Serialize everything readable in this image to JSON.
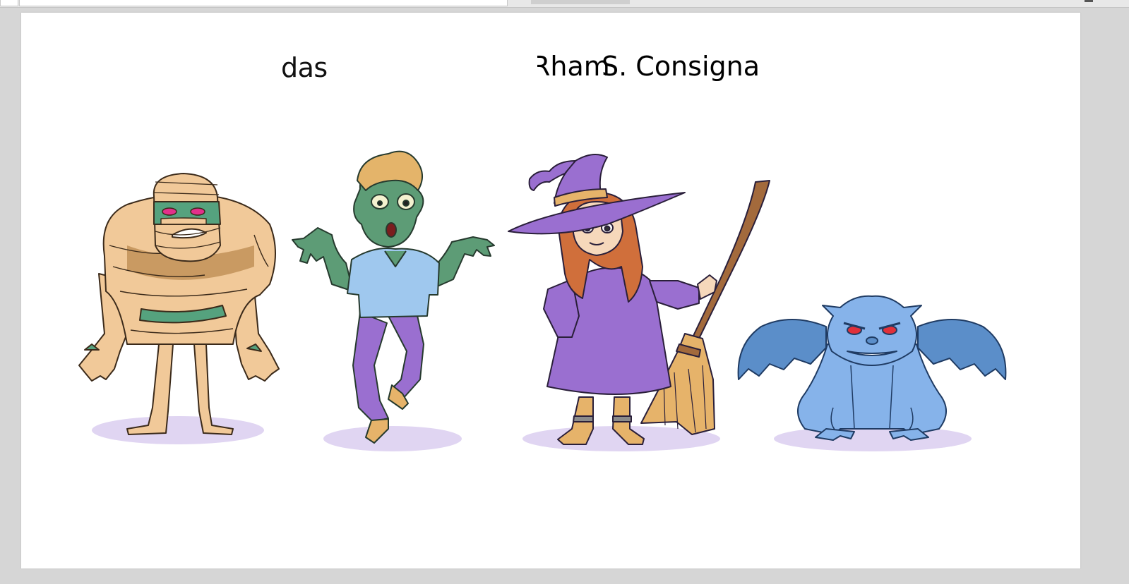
{
  "slide": {
    "text_1": "das",
    "text_2a": "Rham",
    "text_2b": "S. Consigna"
  },
  "characters": [
    {
      "name": "mummy-icon"
    },
    {
      "name": "zombie-icon"
    },
    {
      "name": "witch-icon"
    },
    {
      "name": "gargoyle-icon"
    }
  ],
  "colors": {
    "bandage": "#f1c999",
    "bandage_shade": "#c99a62",
    "mummy_skin": "#55a27e",
    "zombie_skin": "#5d9c76",
    "hair_blond": "#e4b46a",
    "shirt_blue": "#9fc8ee",
    "purple": "#9a6fd0",
    "witch_hair": "#d06f3b",
    "boot": "#e6b36a",
    "gargoyle": "#86b3ea",
    "gargoyle_shade": "#5b8ec9",
    "shadow": "#e0d5f2"
  }
}
